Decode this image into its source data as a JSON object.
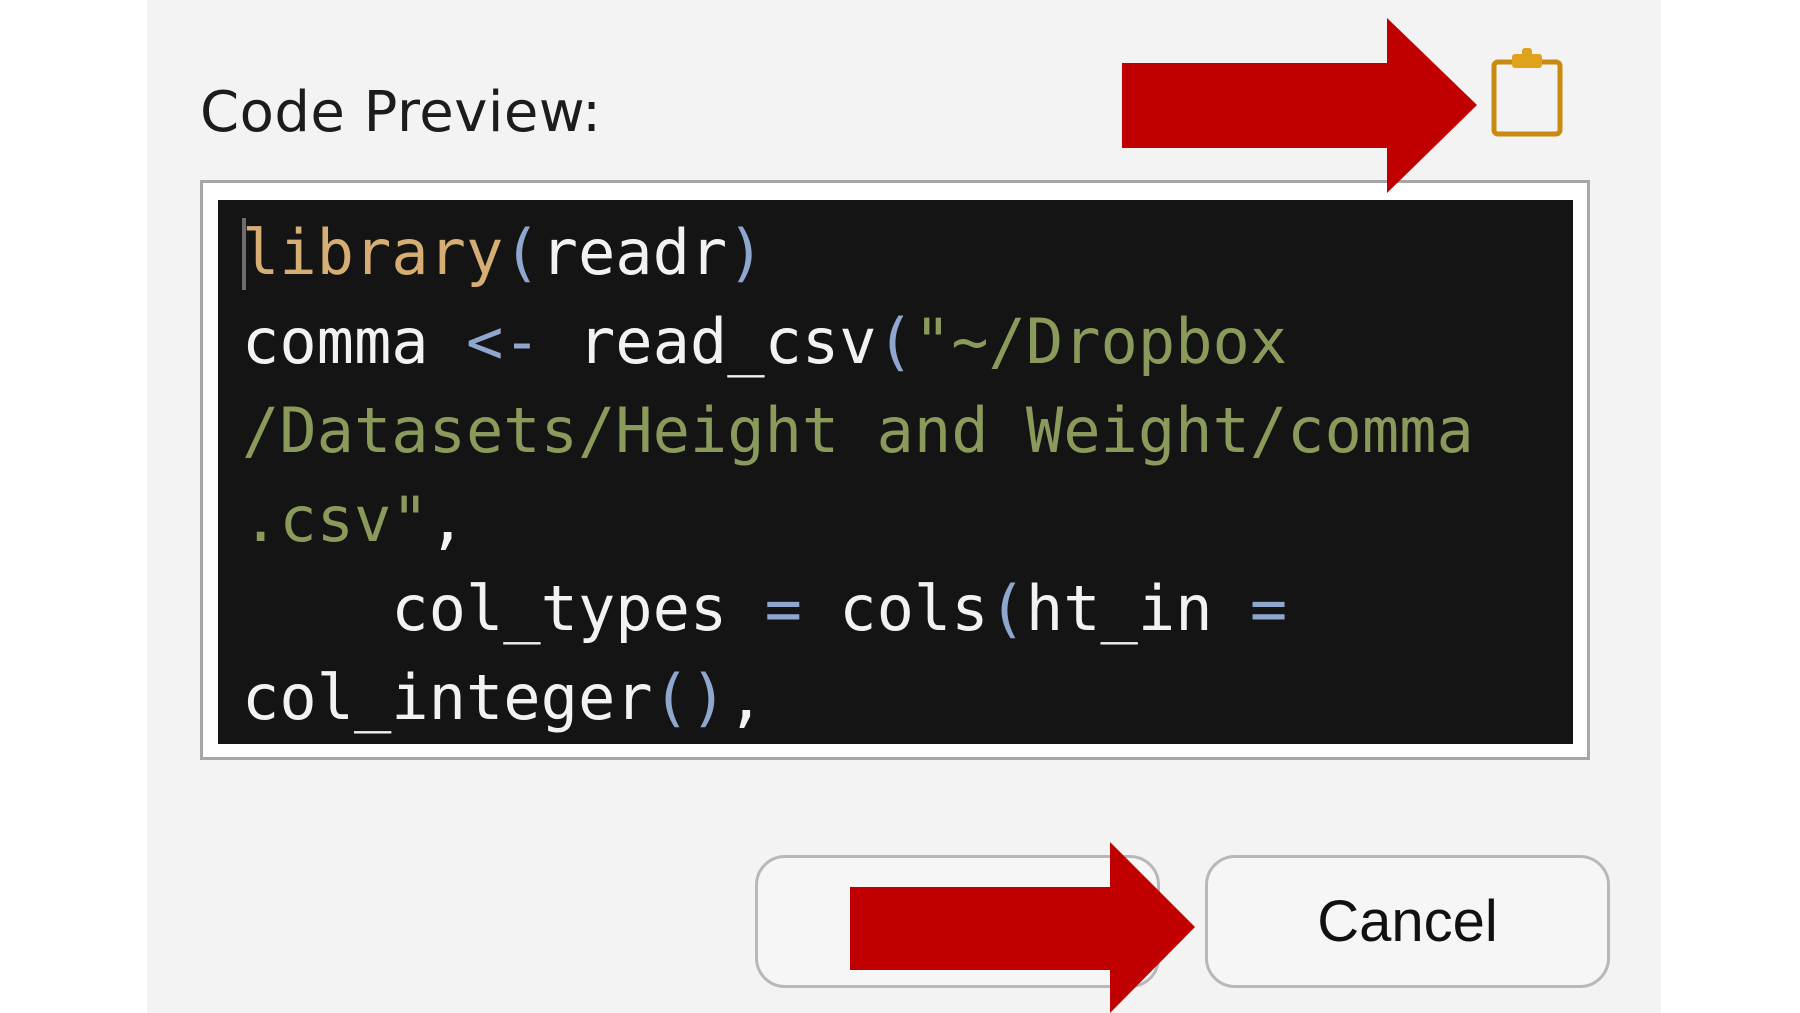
{
  "header": {
    "title": "Code Preview:"
  },
  "toolbar": {
    "copy_icon": "clipboard-icon",
    "copy_icon_color": "#c98a10"
  },
  "code": {
    "lines": [
      [
        {
          "t": "library",
          "c": "fn"
        },
        {
          "t": "(",
          "c": "par"
        },
        {
          "t": "readr",
          "c": "txt"
        },
        {
          "t": ")",
          "c": "par"
        }
      ],
      [
        {
          "t": "comma ",
          "c": "txt"
        },
        {
          "t": "<-",
          "c": "op"
        },
        {
          "t": " read_csv",
          "c": "txt"
        },
        {
          "t": "(",
          "c": "par"
        },
        {
          "t": "\"~/Dropbox",
          "c": "str"
        }
      ],
      [
        {
          "t": "/Datasets/Height and Weight/comma",
          "c": "str"
        }
      ],
      [
        {
          "t": ".csv\"",
          "c": "str"
        },
        {
          "t": ",",
          "c": "txt"
        }
      ],
      [
        {
          "t": "    col_types ",
          "c": "txt"
        },
        {
          "t": "=",
          "c": "op"
        },
        {
          "t": " cols",
          "c": "txt"
        },
        {
          "t": "(",
          "c": "par"
        },
        {
          "t": "ht_in ",
          "c": "txt"
        },
        {
          "t": "=",
          "c": "op"
        }
      ],
      [
        {
          "t": "col_integer",
          "c": "txt"
        },
        {
          "t": "()",
          "c": "par"
        },
        {
          "t": ",",
          "c": "txt"
        }
      ]
    ]
  },
  "buttons": {
    "import_label": "",
    "cancel_label": "Cancel"
  },
  "annotations": {
    "arrow_color": "#c00000"
  }
}
